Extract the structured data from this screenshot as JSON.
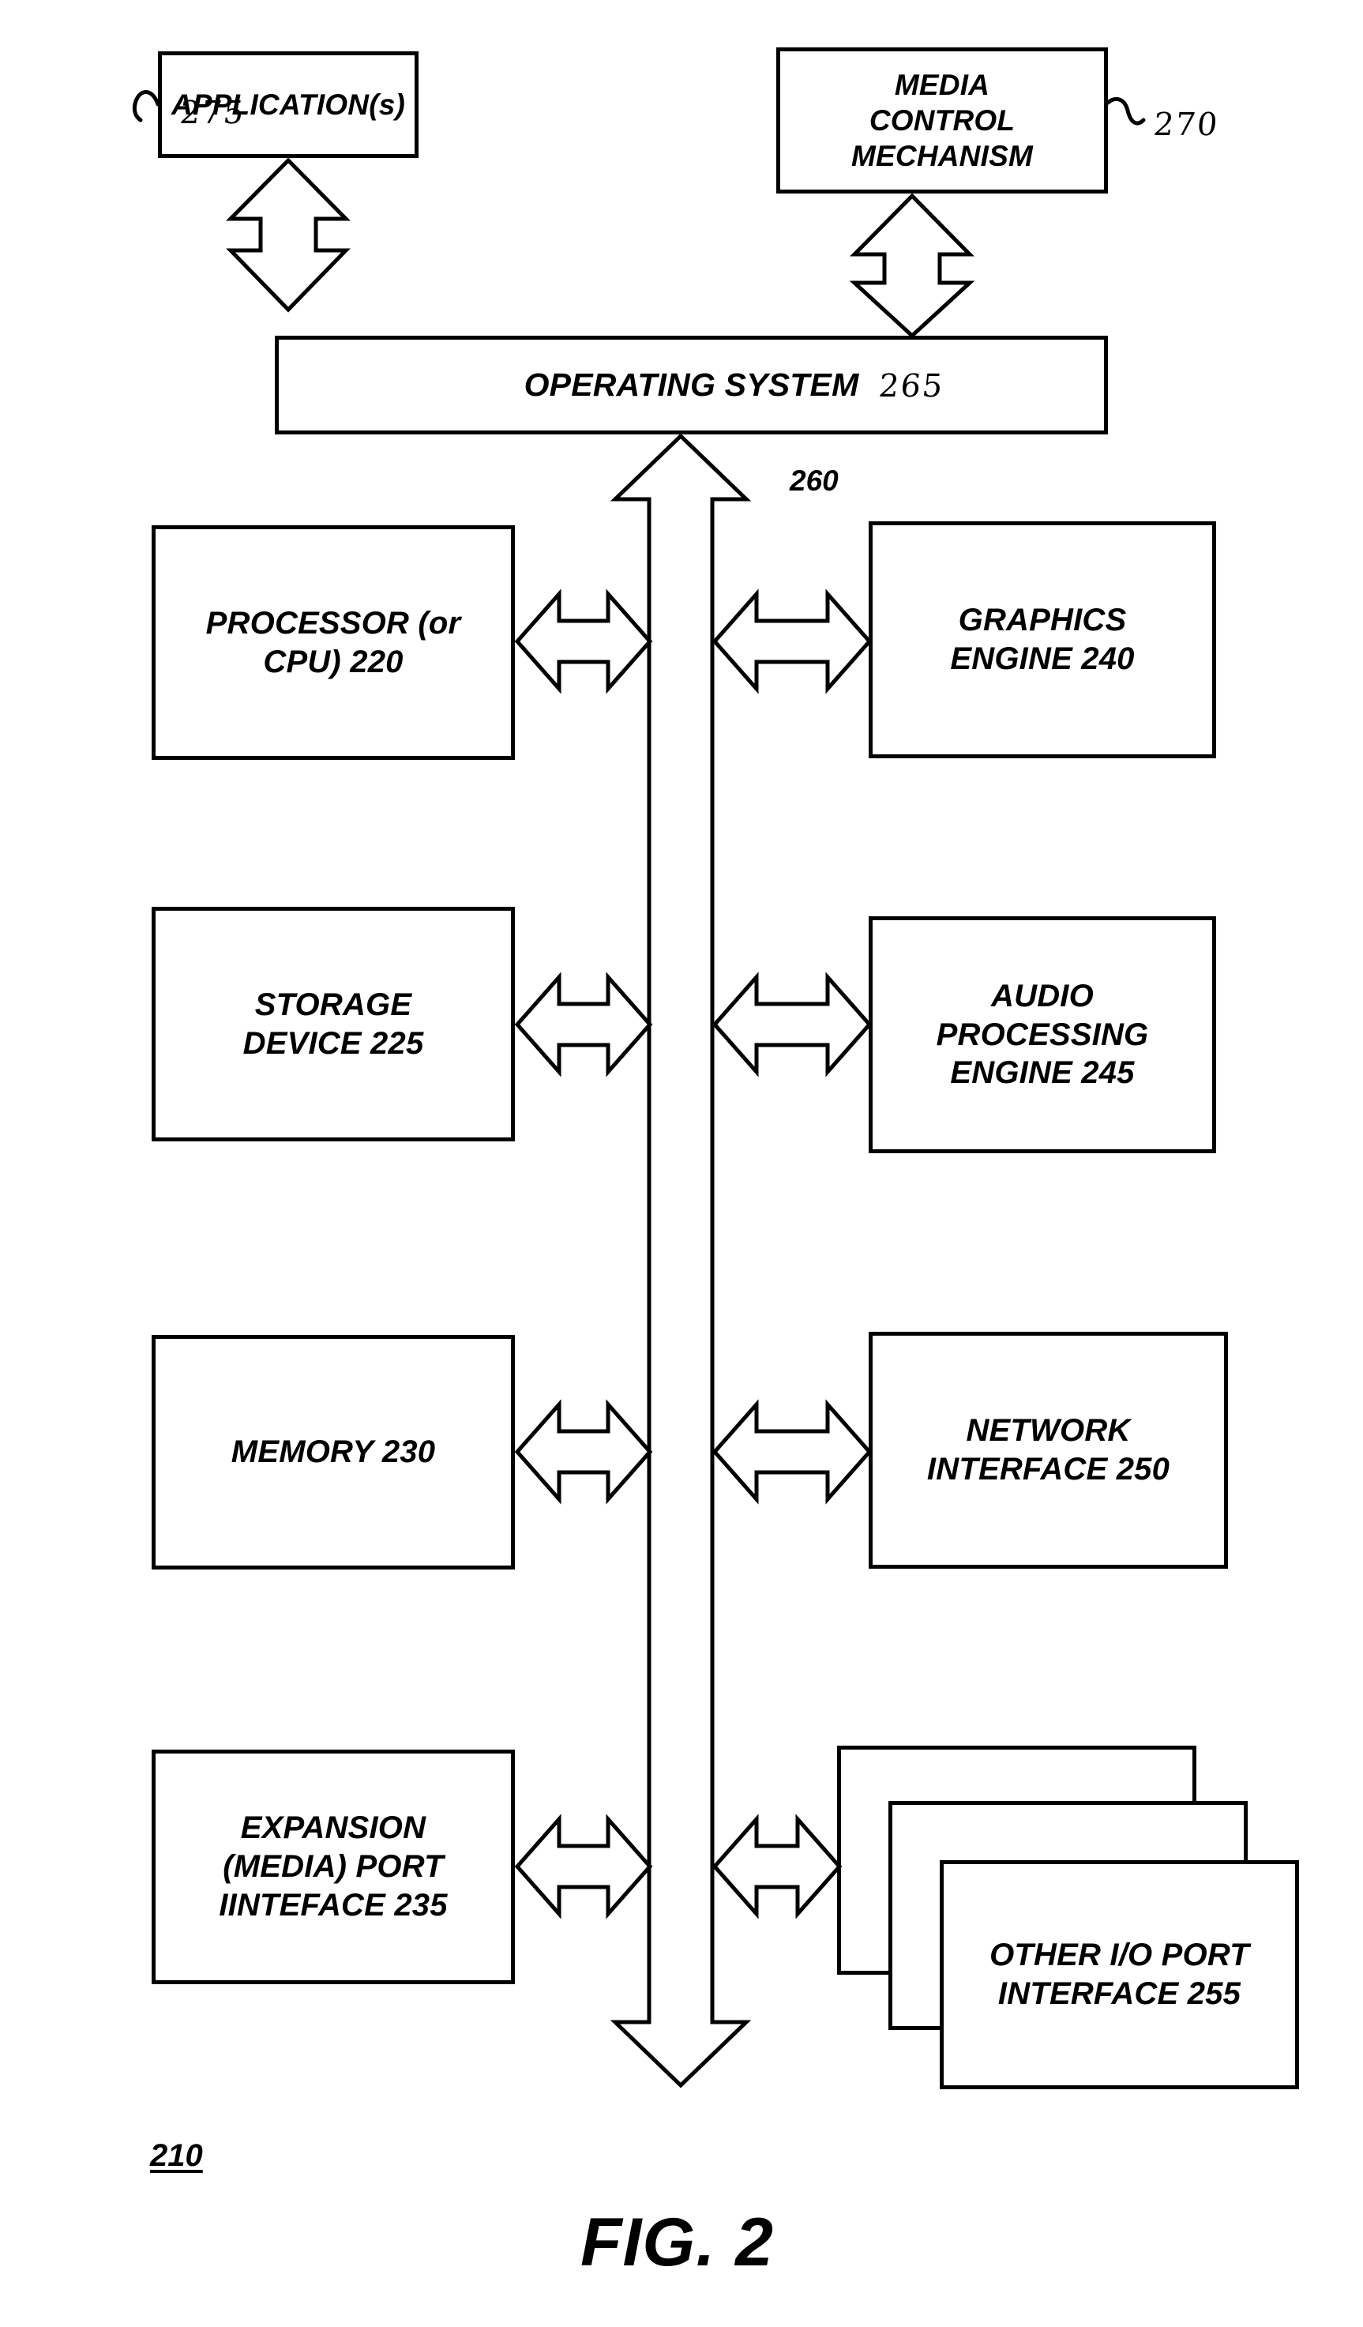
{
  "figure": {
    "caption": "FIG. 2",
    "system_ref": "210"
  },
  "software_layer": {
    "application": {
      "label": "APPLICATION(s)",
      "ref": "275"
    },
    "media_control": {
      "label": "MEDIA\nCONTROL\nMECHANISM",
      "ref": "270"
    },
    "operating_system": {
      "label": "OPERATING SYSTEM",
      "ref": "265"
    }
  },
  "bus": {
    "ref": "260",
    "name": "system-bus"
  },
  "hardware_left": [
    {
      "label": "PROCESSOR (or\nCPU) 220",
      "ref": "220",
      "name": "processor-box"
    },
    {
      "label": "STORAGE\nDEVICE 225",
      "ref": "225",
      "name": "storage-device-box"
    },
    {
      "label": "MEMORY 230",
      "ref": "230",
      "name": "memory-box"
    },
    {
      "label": "EXPANSION\n(MEDIA) PORT\nIINTEFACE 235",
      "ref": "235",
      "name": "expansion-port-box"
    }
  ],
  "hardware_right": [
    {
      "label": "GRAPHICS\nENGINE 240",
      "ref": "240",
      "name": "graphics-engine-box"
    },
    {
      "label": "AUDIO\nPROCESSING\nENGINE 245",
      "ref": "245",
      "name": "audio-engine-box"
    },
    {
      "label": "NETWORK\nINTERFACE 250",
      "ref": "250",
      "name": "network-interface-box"
    },
    {
      "label": "OTHER I/O PORT\nINTERFACE 255",
      "ref": "255",
      "name": "other-io-port-box"
    }
  ],
  "colors": {
    "ink": "#000000",
    "paper": "#ffffff"
  }
}
